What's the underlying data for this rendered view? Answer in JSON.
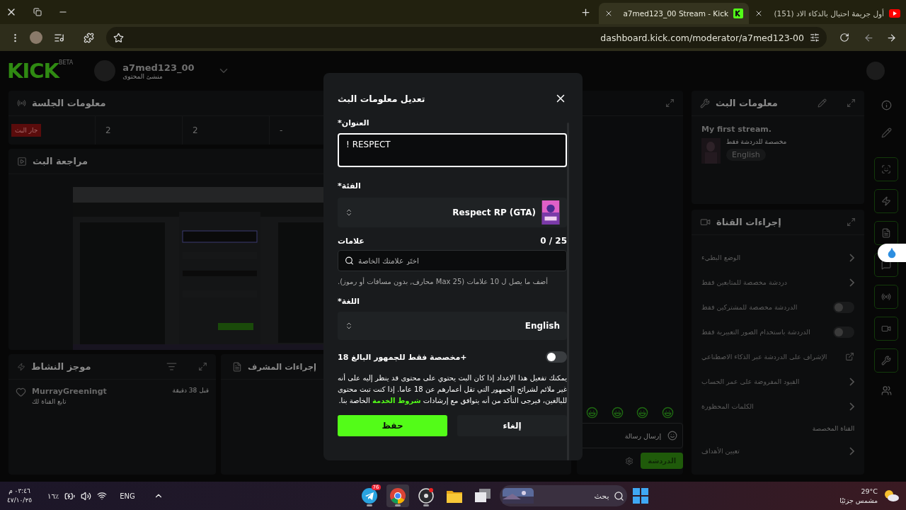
{
  "browser": {
    "tabs": [
      {
        "title": "(151) أول جريمة احتيال بالذكاء الاد",
        "selected": false
      },
      {
        "title": "a7med123_00 Stream - Kick",
        "selected": true
      }
    ],
    "url": "dashboard.kick.com/moderator/a7med123-00"
  },
  "header": {
    "logo": "KICK",
    "logo_badge": "BETA",
    "username": "a7med123_00",
    "role": "منشئ المحتوى"
  },
  "session_info": {
    "title": "معلومات الجلسة",
    "stats": [
      {
        "kind": "plain",
        "text": "-"
      },
      {
        "kind": "plain",
        "text": "2"
      },
      {
        "kind": "plain",
        "text": "2"
      },
      {
        "kind": "badge",
        "text": "جار البث"
      }
    ]
  },
  "stream_review": {
    "title": "مراجعة البث"
  },
  "activity_feed": {
    "title": "موجز النشاط",
    "events": [
      {
        "user": "MurrayGreeningt",
        "action": "تابع القناة لك",
        "time": "قبل 38 دقيقة"
      }
    ]
  },
  "moderator_actions": {
    "title": "إجراءات المشرف"
  },
  "chat": {
    "placeholder": "إرسال رسالة",
    "button": "الدردشة"
  },
  "stream_info": {
    "title": "معلومات البث",
    "stream_title": "My first stream.",
    "category": "مخصصة للدردشة فقط",
    "language": "English"
  },
  "channel_actions": {
    "title": "إجراءات القناة",
    "items": [
      {
        "kind": "chevron",
        "label": "الوضع البطيء"
      },
      {
        "kind": "chevron",
        "label": "دردشة مخصصة للمتابعين فقط"
      },
      {
        "kind": "toggle",
        "label": "الدردشة مخصصة للمشتركين فقط",
        "on": false
      },
      {
        "kind": "toggle",
        "label": "الدردشة باستخدام الصور التعبيرية فقط",
        "on": false
      },
      {
        "kind": "external",
        "label": "الإشراف على الدردشة عبر الذكاء الاصطناعي"
      },
      {
        "kind": "chevron",
        "label": "القيود المفروضة على عمر الحساب"
      },
      {
        "kind": "chevron",
        "label": "الكلمات المحظورة"
      },
      {
        "kind": "section",
        "label": "القناة المخصصة"
      },
      {
        "kind": "chevron",
        "label": "تعيين الأهداف"
      }
    ]
  },
  "modal": {
    "title": "تعديل معلومات البث",
    "title_field": {
      "label": "العنوان*",
      "value": "! RESPECT"
    },
    "category": {
      "label": "الفئة*",
      "value": "Respect RP (GTA)"
    },
    "tags": {
      "label": "علامات",
      "count": "0 / 25",
      "placeholder": "اختَر علامتك الخاصة",
      "hint": "أضف ما يصل ل 10 علامات (Max 25 محارف, بدون مسافات أو رموز)."
    },
    "language": {
      "label": "اللغة*",
      "value": "English"
    },
    "adult": {
      "label": "+مخصصة فقط للجمهور البالغ 18",
      "on": false
    },
    "notice": {
      "before": "يمكنك تفعيل هذا الإعداد إذا كان البث يحتوي على محتوى قد ينظر إليه على أنه غير ملائم لشرائح الجمهور التي تقل أعمارهم عن 18 عاما. إذا كنت تبث محتوى للبالغين، فيرجى التأكد من أنه يتوافق مع إرشادات",
      "link": "شروط الخدمة",
      "after": "الخاصة بنا."
    },
    "save": "حفظ",
    "cancel": "إلغاء"
  },
  "taskbar": {
    "time": "٠٣:٤٦ م",
    "date": "٤٧/١٠/٢٥",
    "battery": "١٦٪",
    "language": "ENG",
    "apps": [
      {
        "kind": "telegram",
        "badge": "76",
        "open": true,
        "active": false
      },
      {
        "kind": "chrome",
        "open": true,
        "active": true
      },
      {
        "kind": "recorder",
        "open": true,
        "active": false
      },
      {
        "kind": "folder",
        "open": false,
        "active": false
      },
      {
        "kind": "windows-app",
        "open": false,
        "active": false
      }
    ],
    "search_label": "بحث",
    "temperature": "29°C",
    "weather": "مشمس جزئيًا"
  }
}
